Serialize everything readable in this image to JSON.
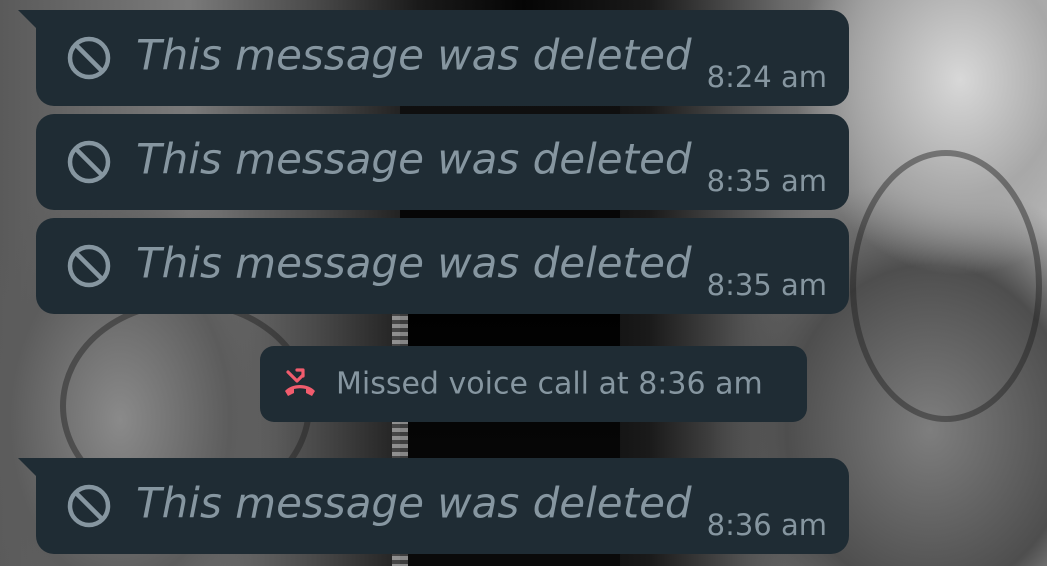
{
  "messages": [
    {
      "text": "This message was deleted",
      "time": "8:24 am",
      "icon": "deleted-icon"
    },
    {
      "text": "This message was deleted",
      "time": "8:35 am",
      "icon": "deleted-icon"
    },
    {
      "text": "This message was deleted",
      "time": "8:35 am",
      "icon": "deleted-icon"
    },
    {
      "text": "This message was deleted",
      "time": "8:36 am",
      "icon": "deleted-icon"
    }
  ],
  "system_notice": {
    "text": "Missed voice call at 8:36 am",
    "icon": "missed-call-icon"
  },
  "colors": {
    "bubble": "#1f2c34",
    "text": "#8696a0",
    "missed_call": "#f15c6d"
  }
}
